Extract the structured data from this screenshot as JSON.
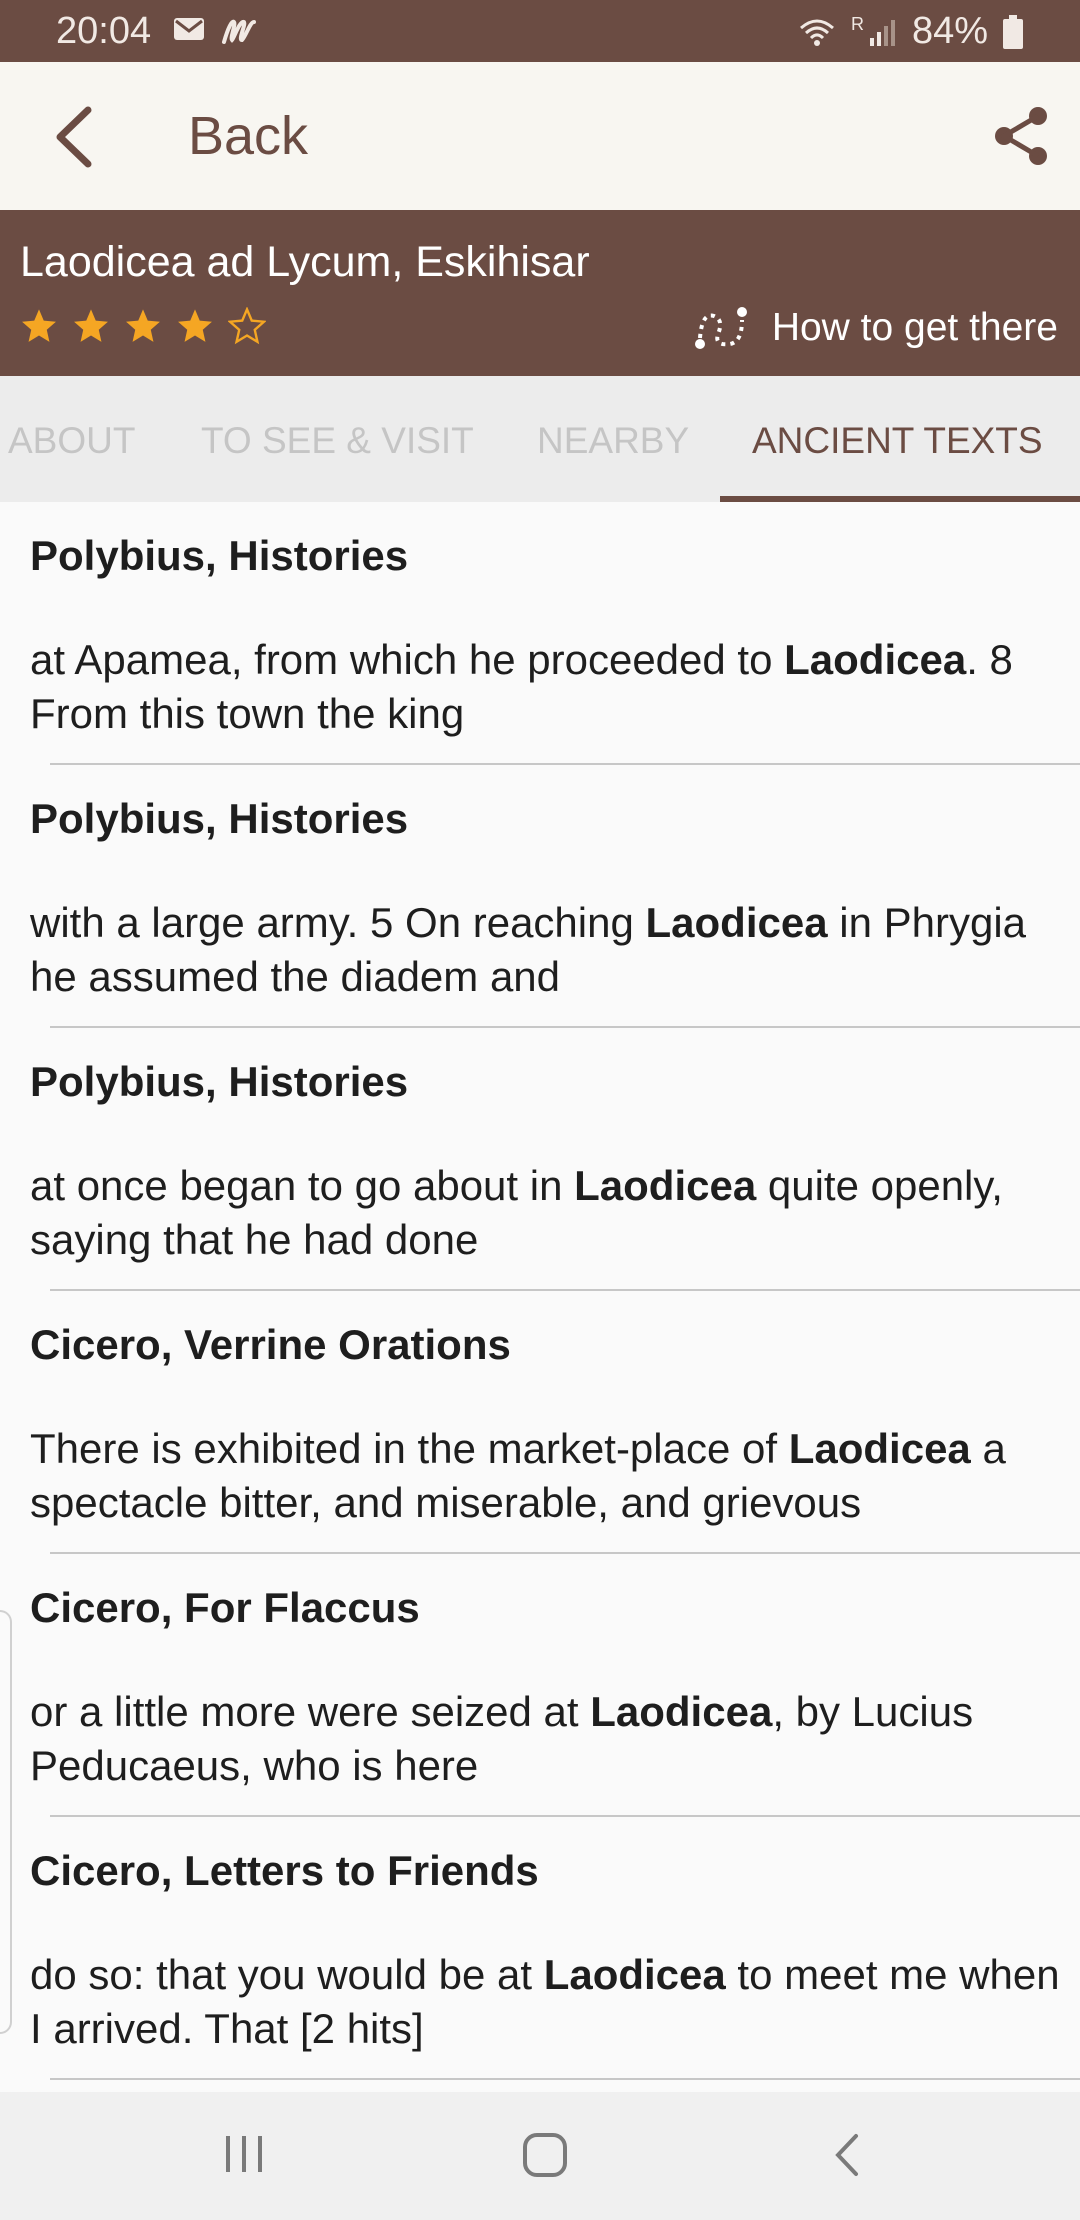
{
  "status": {
    "time": "20:04",
    "battery": "84%",
    "signal_label": "R"
  },
  "appbar": {
    "back_label": "Back"
  },
  "place": {
    "title": "Laodicea ad Lycum, Eskihisar",
    "rating": 4,
    "rating_max": 5,
    "directions_label": "How to get there"
  },
  "tabs": [
    {
      "label": "ABOUT"
    },
    {
      "label": "TO SEE & VISIT"
    },
    {
      "label": "NEARBY"
    },
    {
      "label": "ANCIENT TEXTS"
    }
  ],
  "entries": [
    {
      "source": "Polybius, Histories",
      "before": "at Apamea, from which he proceeded to ",
      "highlight": "Laodicea",
      "after": ". 8 From this town the king"
    },
    {
      "source": "Polybius, Histories",
      "before": "with a large army. 5 On reaching ",
      "highlight": "Laodicea",
      "after": " in Phrygia he assumed the diadem and"
    },
    {
      "source": "Polybius, Histories",
      "before": "at once began to go about in ",
      "highlight": "Laodicea",
      "after": " quite openly, saying that he had done"
    },
    {
      "source": "Cicero, Verrine Orations",
      "before": "There is exhibited in the market-place of ",
      "highlight": "Laodicea",
      "after": " a spectacle bitter, and miserable, and grievous"
    },
    {
      "source": "Cicero, For Flaccus",
      "before": "or a little more were seized at ",
      "highlight": "Laodicea",
      "after": ", by Lucius Peducaeus, who is here"
    },
    {
      "source": "Cicero, Letters to Friends",
      "before": "do so: that you would be at ",
      "highlight": "Laodicea",
      "after": " to meet me when I arrived. That [2 hits]"
    }
  ],
  "colors": {
    "brand": "#6b4c43",
    "star": "#f5a623"
  }
}
